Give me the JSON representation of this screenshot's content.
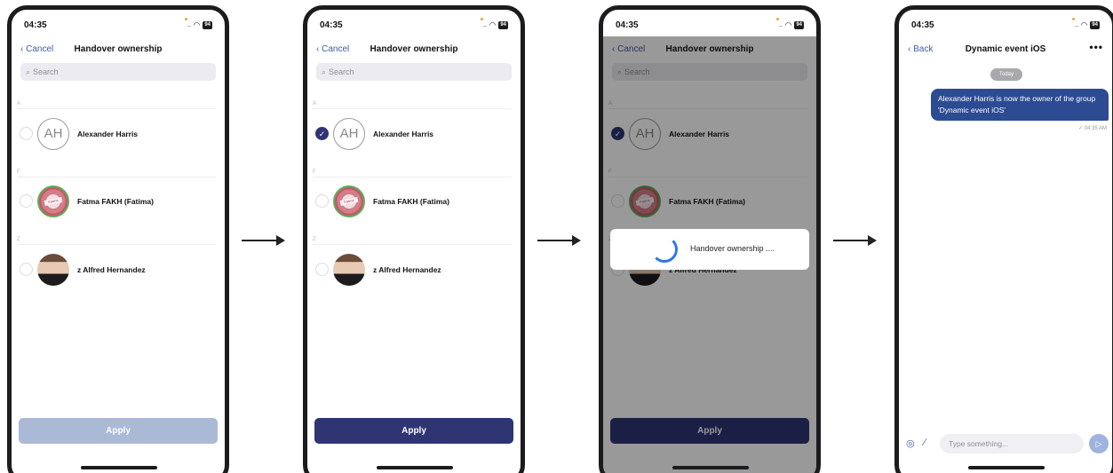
{
  "status": {
    "time": "04:35",
    "battery": "94"
  },
  "select_screen": {
    "cancel_label": "Cancel",
    "title": "Handover ownership",
    "search_placeholder": "Search",
    "sections": [
      "A",
      "F",
      "Z"
    ],
    "contacts": [
      {
        "name": "Alexander Harris",
        "initials": "AH"
      },
      {
        "name": "Fatma FAKH (Fatima)",
        "avatar_text": "Fatma"
      },
      {
        "name": "z Alfred Hernandez"
      }
    ],
    "apply_label": "Apply"
  },
  "dialog": {
    "text": "Handover ownership ...."
  },
  "chat_screen": {
    "back_label": "Back",
    "title": "Dynamic event iOS",
    "more_label": "•••",
    "date_chip": "Today",
    "message": "Alexander Harris is now the owner of the group 'Dynamic event iOS'",
    "message_time": "✓ 04:35 AM",
    "composer_placeholder": "Type something..."
  },
  "colors": {
    "accent": "#2f3473",
    "link": "#3b5da8",
    "apply_disabled": "#aab9d6",
    "bubble": "#2c4b93"
  }
}
